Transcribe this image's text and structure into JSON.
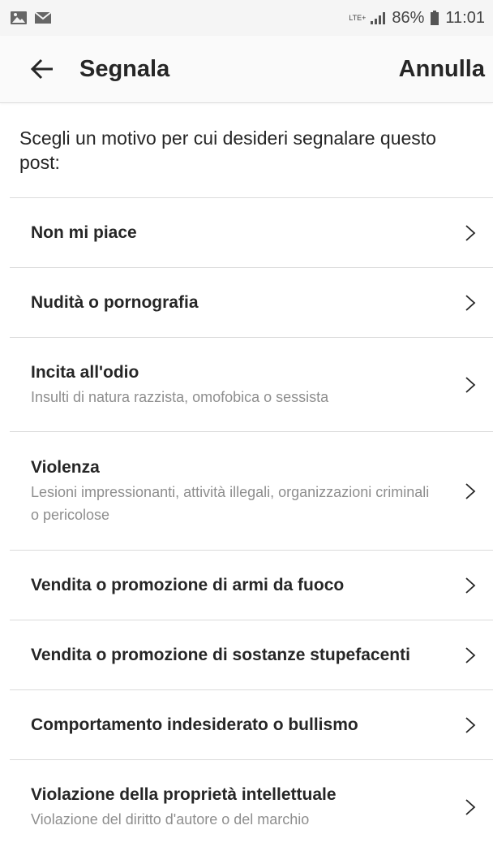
{
  "status_bar": {
    "network_type": "LTE+",
    "battery": "86%",
    "time": "11:01"
  },
  "header": {
    "title": "Segnala",
    "cancel_label": "Annulla"
  },
  "prompt": "Scegli un motivo per cui desideri segnalare questo post:",
  "items": [
    {
      "title": "Non mi piace",
      "subtitle": ""
    },
    {
      "title": "Nudità o pornografia",
      "subtitle": ""
    },
    {
      "title": "Incita all'odio",
      "subtitle": "Insulti di natura razzista, omofobica o sessista"
    },
    {
      "title": "Violenza",
      "subtitle": "Lesioni impressionanti, attività illegali, organizzazioni criminali o pericolose"
    },
    {
      "title": "Vendita o promozione di armi da fuoco",
      "subtitle": ""
    },
    {
      "title": "Vendita o promozione di sostanze stupefacenti",
      "subtitle": ""
    },
    {
      "title": "Comportamento indesiderato o bullismo",
      "subtitle": ""
    },
    {
      "title": "Violazione della proprietà intellettuale",
      "subtitle": "Violazione del diritto d'autore o del marchio"
    }
  ],
  "icons": {
    "back": "arrow-left-icon",
    "chevron": "chevron-right-icon",
    "gallery": "image-icon",
    "mail": "mail-icon"
  }
}
